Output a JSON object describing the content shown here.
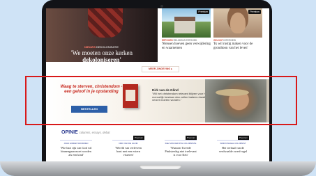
{
  "hero": {
    "kicker_brand": "NIEUWS",
    "kicker_rest": "DEKOLONISATIE",
    "title_line1": "'We moeten onze kerken",
    "title_line2": "dekoloniseren'"
  },
  "cards": [
    {
      "badge": "Premium",
      "kicker_brand": "ERFGOED",
      "kicker_rest": "RELIGIEUS ERFGOED",
      "title": "'Mensen hoeven geen verwijdering en waarnemen"
    },
    {
      "badge": "Premium",
      "kicker_brand": "GELOOF",
      "kicker_rest": "INTERVIEW",
      "title": "'Ik wil rustig maken voor de grondtoon van het leven'"
    }
  ],
  "more_button": "MEER ZINGEVING ▸",
  "ad": {
    "tagline": "Waag te sterven, christendom - een geloof in je opstanding",
    "order_button": "BESTELLEN",
    "author": "Dirk van de Glind",
    "quote": "\"Wil het christendom relevant blijven voor het menselijk bestaan dan zullen bakens drastisch verzet moeten worden.\""
  },
  "opinion": {
    "heading": "OPINIE",
    "subheading": "columns, essays, debat",
    "items": [
      {
        "kicker": "JOHN HIDDEN WOORDEN",
        "title": "'Wie hart rijk van God wil binnengaan moet worden als een kind'",
        "premium": ""
      },
      {
        "kicker": "DIRK VAN DE GLIND",
        "title": "'Wereld van verleveen bont met een extern visseren'",
        "premium": "Premium"
      },
      {
        "kicker": "INEZ VAN DER PIJL COLUMNISTE",
        "title": "'Waarom Tweede Pinksterdag niet irrelevant is voor Keti'",
        "premium": "Premium"
      },
      {
        "kicker": "SIMON WAGEL COLUMNIST",
        "title": "Het verhaal van de verdwaalde zwerfvogel",
        "premium": "Premium"
      }
    ]
  },
  "colors": {
    "accent_red": "#d8191a",
    "brand_blue": "#2b3a8f",
    "button_blue": "#2d5fa8"
  }
}
